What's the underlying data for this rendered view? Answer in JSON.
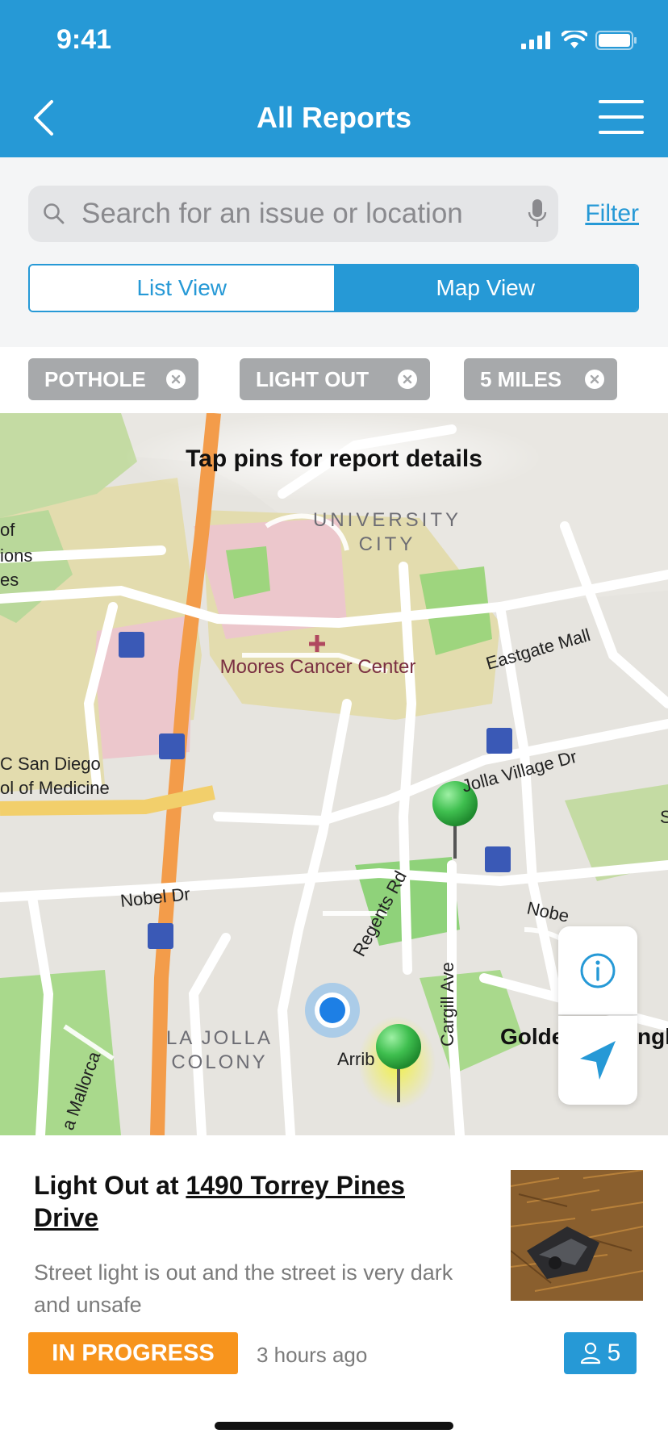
{
  "status_bar": {
    "time": "9:41"
  },
  "nav": {
    "title": "All Reports"
  },
  "search": {
    "placeholder": "Search for an issue or location",
    "filter_label": "Filter"
  },
  "view_toggle": {
    "list_label": "List View",
    "map_label": "Map View",
    "selected": "Map View"
  },
  "chips": [
    {
      "label": "POTHOLE"
    },
    {
      "label": "LIGHT OUT"
    },
    {
      "label": "5 MILES"
    }
  ],
  "map": {
    "hint": "Tap pins for report details",
    "labels": {
      "area_university": "UNIVERSITY",
      "area_city": "CITY",
      "cancer_center": "Moores Cancer Center",
      "eastgate": "Eastgate Mall",
      "lajolla_village": "Jolla Village Dr",
      "nobel_left": "Nobel Dr",
      "nobel_right": "Nobe",
      "regents": "Regents Rd",
      "cargill": "Cargill Ave",
      "la_jolla": "LA JOLLA",
      "colony": "COLONY",
      "arriba": "Arrib",
      "golden_left": "Golde",
      "golden_right": "ngl",
      "mallorca": "a Mallorca",
      "uc_sd": "C San Diego",
      "medicine": "ol of Medicine",
      "of": "of",
      "ions": "ions",
      "es": "es",
      "edge_s": "S"
    }
  },
  "report": {
    "title_prefix": "Light Out at ",
    "address": "1490 Torrey Pines Drive",
    "description": "Street light is out and the street is very dark and unsafe",
    "status": "IN PROGRESS",
    "time_ago": "3 hours ago",
    "followers": "5"
  },
  "colors": {
    "primary": "#2699d6",
    "status_in_progress": "#f7941d",
    "chip_bg": "#a7a9ab",
    "pin_green": "#3fbf4f"
  }
}
